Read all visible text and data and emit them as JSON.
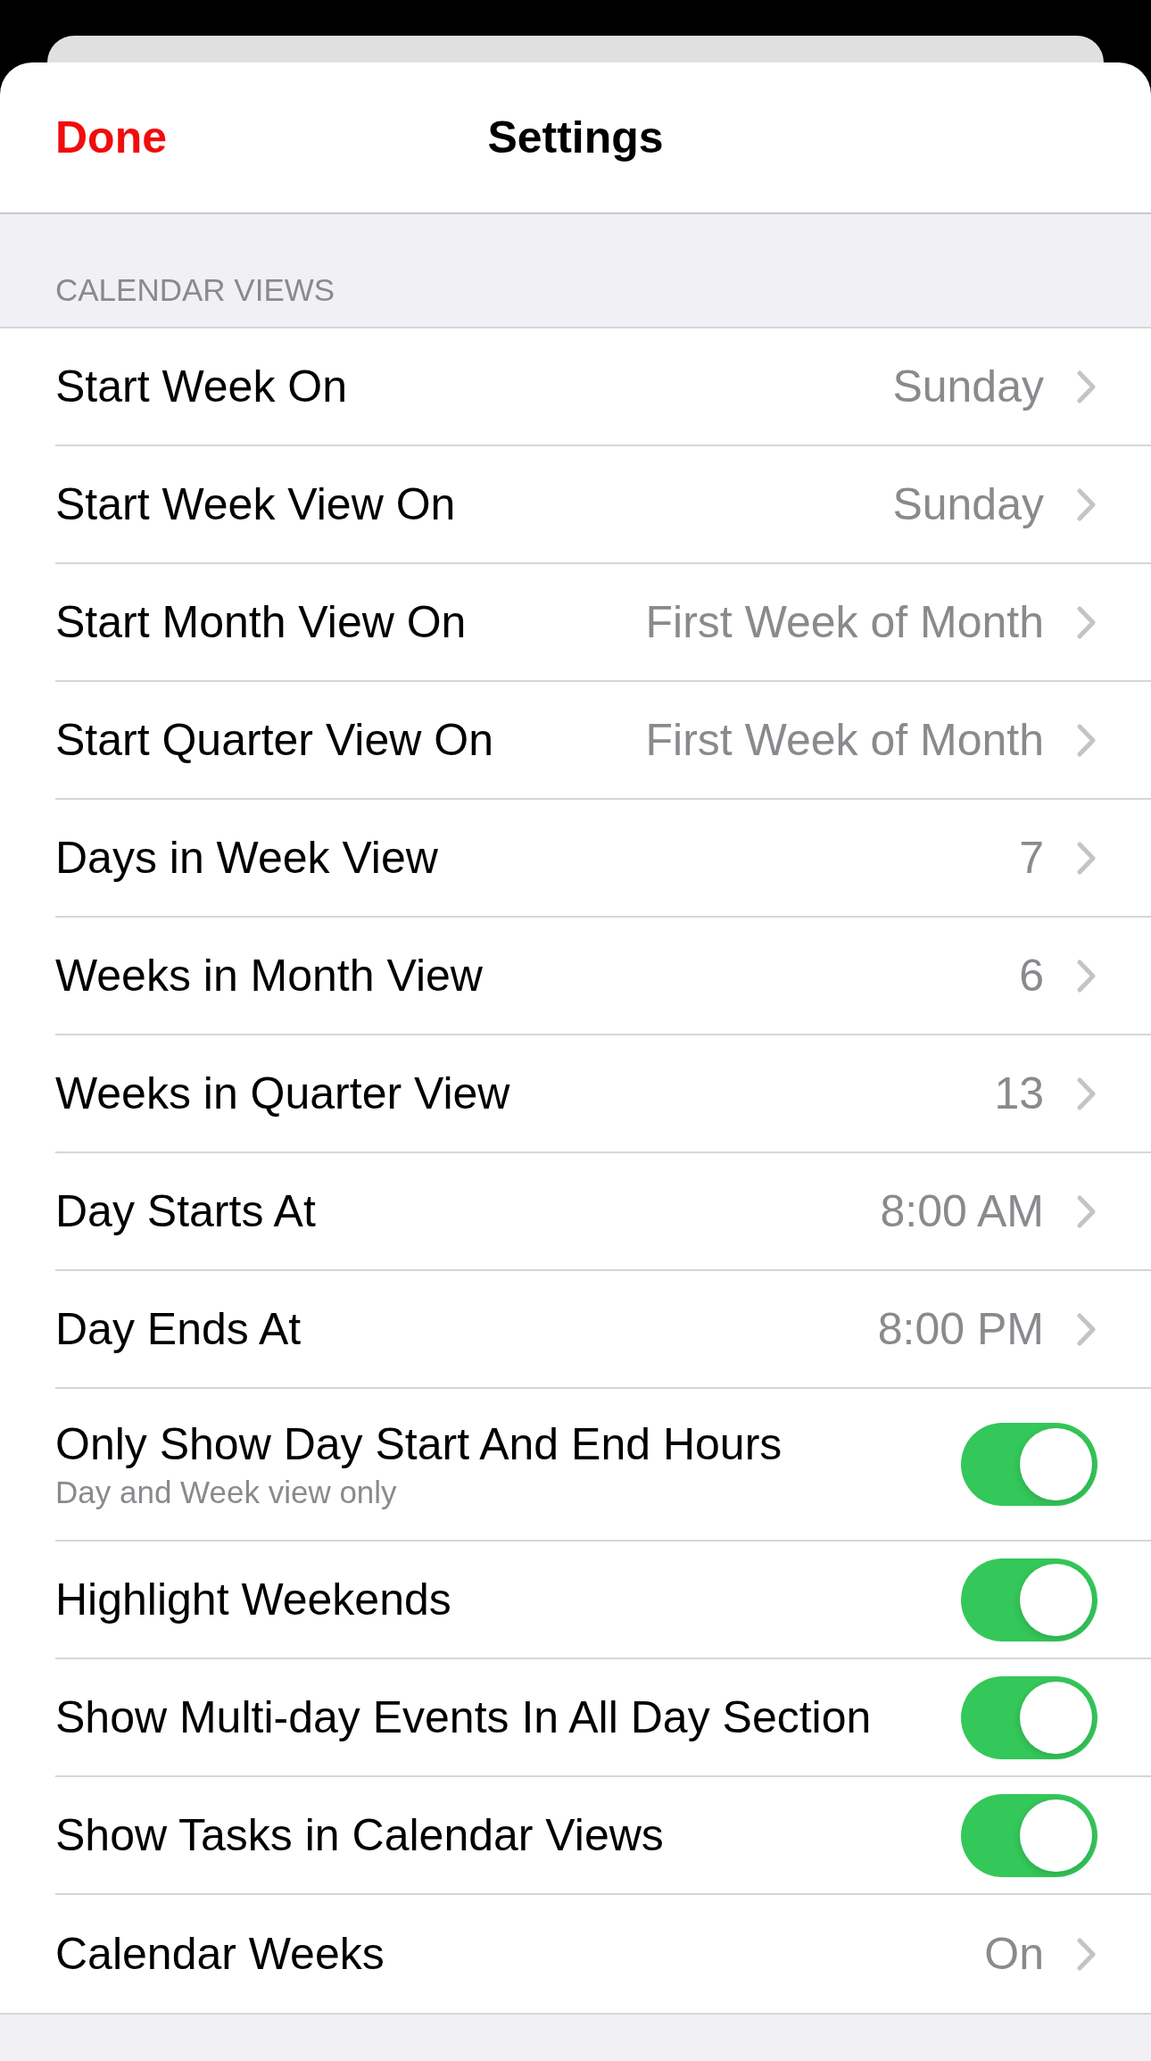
{
  "header": {
    "done_button": "Done",
    "title": "Settings"
  },
  "section": {
    "title": "CALENDAR VIEWS",
    "rows": [
      {
        "kind": "link",
        "label": "Start Week On",
        "value": "Sunday"
      },
      {
        "kind": "link",
        "label": "Start Week View On",
        "value": "Sunday"
      },
      {
        "kind": "link",
        "label": "Start Month View On",
        "value": "First Week of Month"
      },
      {
        "kind": "link",
        "label": "Start Quarter View On",
        "value": "First Week of Month"
      },
      {
        "kind": "link",
        "label": "Days in Week View",
        "value": "7"
      },
      {
        "kind": "link",
        "label": "Weeks in Month View",
        "value": "6"
      },
      {
        "kind": "link",
        "label": "Weeks in Quarter View",
        "value": "13"
      },
      {
        "kind": "link",
        "label": "Day Starts At",
        "value": "8:00 AM"
      },
      {
        "kind": "link",
        "label": "Day Ends At",
        "value": "8:00 PM"
      },
      {
        "kind": "toggle",
        "label": "Only Show Day Start And End Hours",
        "subtitle": "Day and Week view only",
        "on": true
      },
      {
        "kind": "toggle",
        "label": "Highlight Weekends",
        "on": true
      },
      {
        "kind": "toggle",
        "label": "Show Multi-day Events In All Day Section",
        "on": true
      },
      {
        "kind": "toggle",
        "label": "Show Tasks in Calendar Views",
        "on": true
      },
      {
        "kind": "link",
        "label": "Calendar Weeks",
        "value": "On"
      }
    ]
  }
}
